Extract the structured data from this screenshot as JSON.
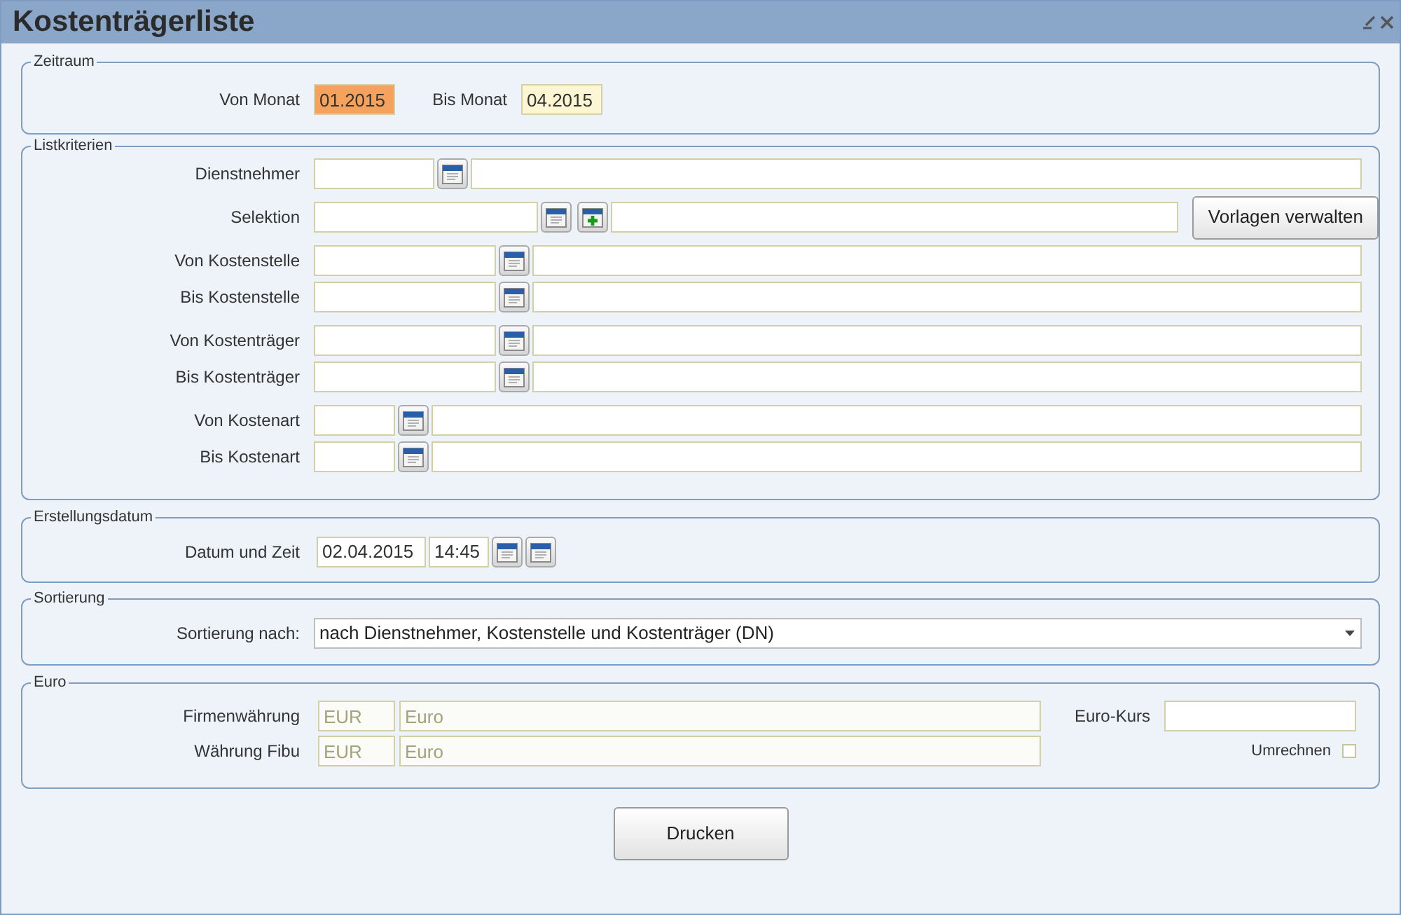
{
  "window": {
    "title": "Kostenträgerliste"
  },
  "zeitraum": {
    "legend": "Zeitraum",
    "fields": [
      {
        "label": "Von Monat",
        "value": "01.2015",
        "focused": true
      },
      {
        "label": "Bis Monat",
        "value": "04.2015",
        "focused": false
      }
    ]
  },
  "listkriterien": {
    "legend": "Listkriterien",
    "manage_button": "Vorlagen verwalten",
    "groups": [
      [
        {
          "label": "Dienstnehmer",
          "kind": "employee",
          "add_button": false
        },
        {
          "label": "Selektion",
          "kind": "selection",
          "add_button": true
        }
      ],
      [
        {
          "label": "Von Kostenstelle",
          "kind": "cost_center",
          "add_button": false
        },
        {
          "label": "Bis Kostenstelle",
          "kind": "cost_center",
          "add_button": false
        }
      ],
      [
        {
          "label": "Von Kostenträger",
          "kind": "cost_unit",
          "add_button": false
        },
        {
          "label": "Bis Kostenträger",
          "kind": "cost_unit",
          "add_button": false
        }
      ],
      [
        {
          "label": "Von Kostenart",
          "kind": "cost_type",
          "add_button": false
        },
        {
          "label": "Bis Kostenart",
          "kind": "cost_type",
          "add_button": false
        }
      ]
    ]
  },
  "erstellungsdatum": {
    "legend": "Erstellungsdatum",
    "label": "Datum und Zeit",
    "date": "02.04.2015",
    "time": "14:45"
  },
  "sortierung": {
    "legend": "Sortierung",
    "label": "Sortierung nach:",
    "value": "nach Dienstnehmer, Kostenstelle und Kostenträger (DN)"
  },
  "euro": {
    "legend": "Euro",
    "rows": [
      {
        "label": "Firmenwährung",
        "code": "EUR",
        "name": "Euro"
      },
      {
        "label": "Währung Fibu",
        "code": "EUR",
        "name": "Euro"
      }
    ],
    "rate_label": "Euro-Kurs",
    "convert_label": "Umrechnen",
    "convert_checked": false
  },
  "print_button": "Drucken"
}
